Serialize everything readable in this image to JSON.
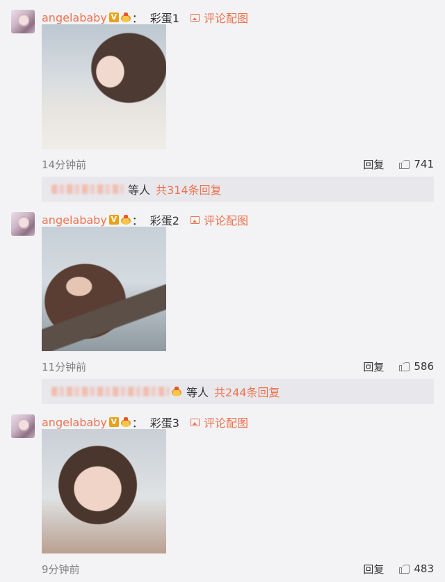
{
  "comments": [
    {
      "username": "angelababy",
      "verified_mark": "V",
      "colon": "：",
      "text": "彩蛋1",
      "pic_link": "评论配图",
      "time": "14分钟前",
      "reply_label": "回复",
      "likes": "741",
      "sub": {
        "etc_label": "等人",
        "total_label": "共314条回复"
      }
    },
    {
      "username": "angelababy",
      "verified_mark": "V",
      "colon": "：",
      "text": "彩蛋2",
      "pic_link": "评论配图",
      "time": "11分钟前",
      "reply_label": "回复",
      "likes": "586",
      "sub": {
        "etc_label": "等人",
        "total_label": "共244条回复"
      }
    },
    {
      "username": "angelababy",
      "verified_mark": "V",
      "colon": "：",
      "text": "彩蛋3",
      "pic_link": "评论配图",
      "time": "9分钟前",
      "reply_label": "回复",
      "likes": "483"
    }
  ],
  "colors": {
    "accent": "#eb7350",
    "background": "#f3f3f6",
    "subbox": "#e8e8ec",
    "muted": "#808080"
  },
  "icons": [
    "verified-v-icon",
    "member-crown-icon",
    "image-icon",
    "thumbs-up-icon"
  ]
}
